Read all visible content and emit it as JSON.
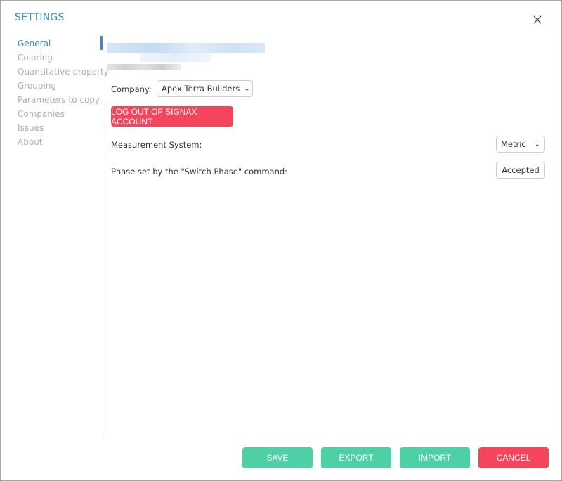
{
  "window": {
    "title": "SETTINGS"
  },
  "sidebar": {
    "items": [
      {
        "label": "General"
      },
      {
        "label": "Coloring"
      },
      {
        "label": "Quantitative property"
      },
      {
        "label": "Grouping"
      },
      {
        "label": "Parameters to copy"
      },
      {
        "label": "Companies"
      },
      {
        "label": "Issues"
      },
      {
        "label": "About"
      }
    ]
  },
  "general": {
    "company_label": "Company:",
    "company_value": "Apex Terra Builders",
    "logout_label": "LOG OUT OF SIGNAX ACCOUNT",
    "measurement_label": "Measurement System:",
    "measurement_value": "Metric",
    "phase_label": "Phase set by the \"Switch Phase\" command:",
    "phase_value": "Accepted"
  },
  "footer": {
    "save": "SAVE",
    "export": "EXPORT",
    "import": "IMPORT",
    "cancel": "CANCEL"
  },
  "colors": {
    "accent": "#3d87c9",
    "danger": "#f5455c",
    "success": "#4fcfa5"
  },
  "icons": {
    "close": "close-icon",
    "chevron": "chevron-down-icon"
  }
}
